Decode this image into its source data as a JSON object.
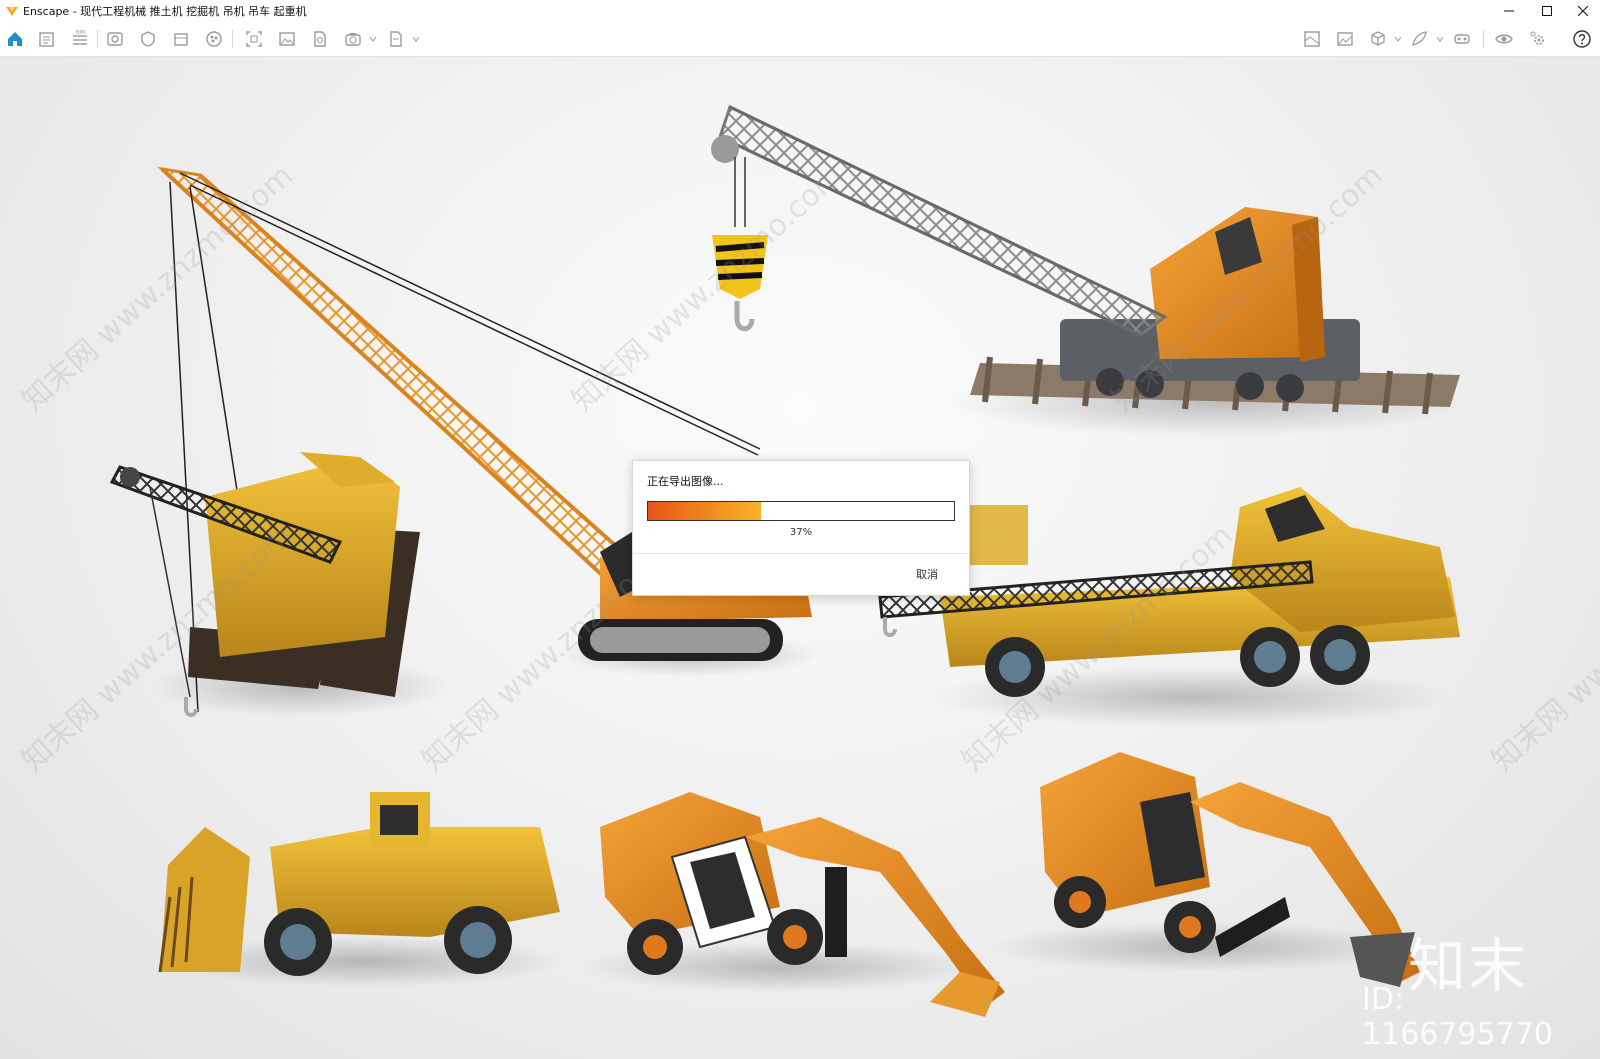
{
  "window": {
    "app_name": "Enscape",
    "title": "Enscape - 现代工程机械 推土机 挖掘机 吊机 吊车 起重机",
    "controls": [
      "minimize-icon",
      "maximize-icon",
      "close-icon"
    ]
  },
  "toolbar": {
    "left_icons": [
      "home-icon",
      "asset-library-icon",
      "bim-info-icon",
      "views-icon",
      "visual-settings-icon",
      "sunlight-icon",
      "materials-icon",
      "panorama-icon",
      "screenshot-icon",
      "export-image-icon",
      "batch-render-icon",
      "video-editor-icon",
      "export-file-icon"
    ],
    "right_icons": [
      "site-context-icon",
      "upload-icon",
      "cube-icon",
      "feedback-icon",
      "vr-headset-icon",
      "eye-icon",
      "settings-icon",
      "help-icon"
    ],
    "accent_color": "#1e90c8"
  },
  "dialog": {
    "message": "正在导出图像...",
    "progress_percent": 37,
    "progress_label": "37%",
    "cancel_label": "取消",
    "progress_colors": [
      "#e8521a",
      "#f7b42a"
    ]
  },
  "watermark": {
    "repeat_text": "知末网 www.znzmo.com",
    "brand": "知末",
    "id_label": "ID: 1166795770"
  }
}
